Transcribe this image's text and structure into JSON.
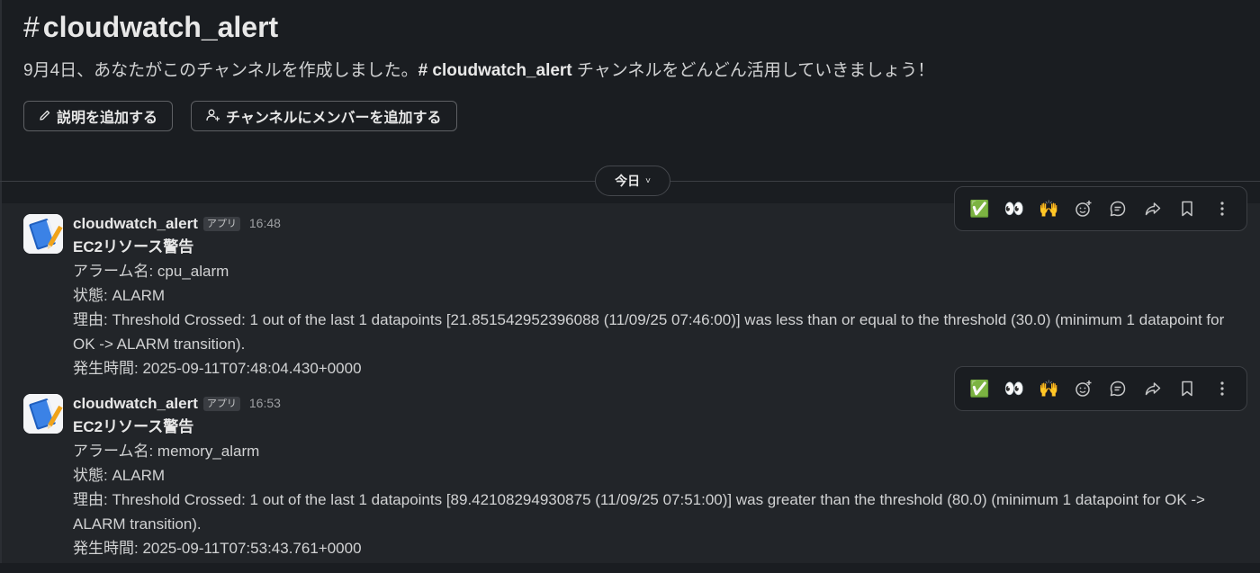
{
  "channel": {
    "hash": "#",
    "name": "cloudwatch_alert"
  },
  "intro": {
    "before": "9月4日、あなたがこのチャンネルを作成しました。",
    "channel_link": "# cloudwatch_alert",
    "after": " チャンネルをどんどん活用していきましょう！"
  },
  "actions": {
    "add_description": "説明を追加する",
    "add_members": "チャンネルにメンバーを追加する"
  },
  "date_divider": {
    "label": "今日",
    "chevron": "˅"
  },
  "toolbar": {
    "check": "✅",
    "eyes": "👀",
    "raised_hands": "🙌"
  },
  "messages": [
    {
      "sender": "cloudwatch_alert",
      "badge": "アプリ",
      "time": "16:48",
      "title": "EC2リソース警告",
      "alarm_name": "アラーム名: cpu_alarm",
      "state": "状態: ALARM",
      "reason": "理由: Threshold Crossed: 1 out of the last 1 datapoints [21.851542952396088 (11/09/25 07:46:00)] was less than or equal to the threshold (30.0) (minimum 1 datapoint for OK -> ALARM transition).",
      "occurred": "発生時間: 2025-09-11T07:48:04.430+0000"
    },
    {
      "sender": "cloudwatch_alert",
      "badge": "アプリ",
      "time": "16:53",
      "title": "EC2リソース警告",
      "alarm_name": "アラーム名: memory_alarm",
      "state": "状態: ALARM",
      "reason": "理由: Threshold Crossed: 1 out of the last 1 datapoints [89.42108294930875 (11/09/25 07:51:00)] was greater than the threshold (80.0) (minimum 1 datapoint for OK -> ALARM transition).",
      "occurred": "発生時間: 2025-09-11T07:53:43.761+0000"
    }
  ]
}
